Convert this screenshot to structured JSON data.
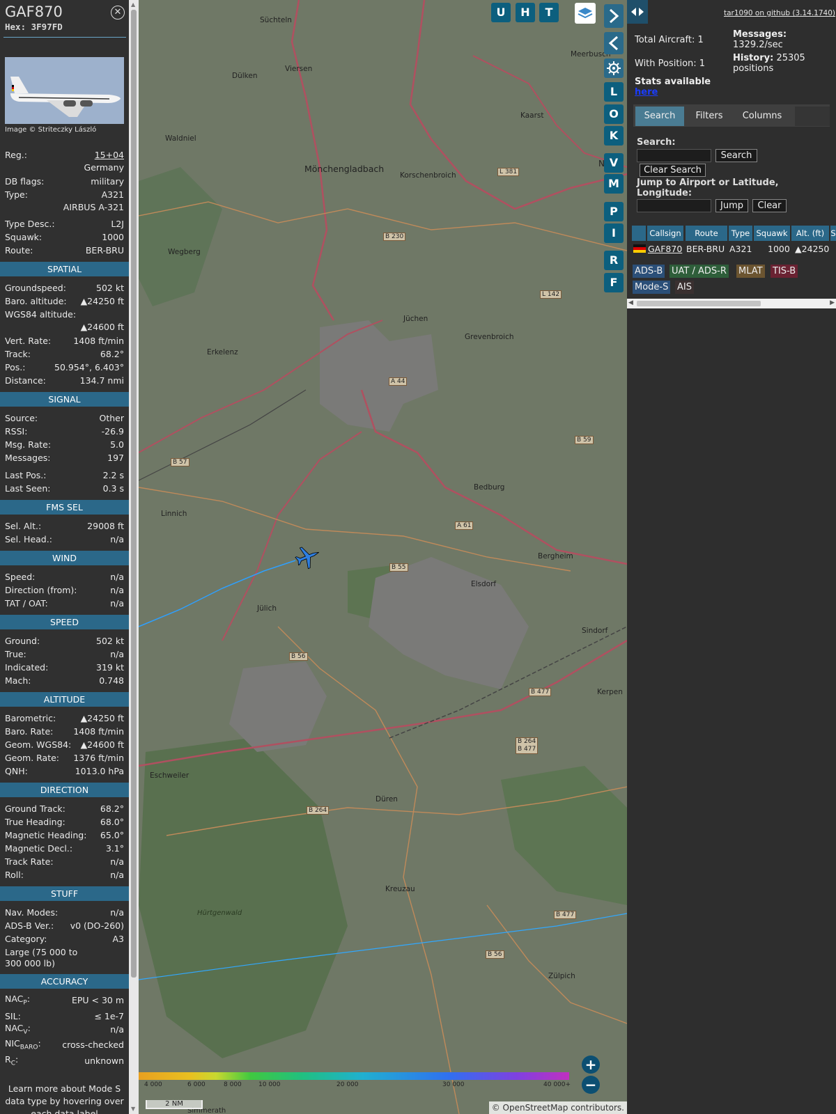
{
  "aircraft": {
    "callsign": "GAF870",
    "hex": "Hex: 3F97FD",
    "photo_credit": "Image © Striteczky László"
  },
  "details": [
    {
      "label": "Reg.:",
      "value": "15+04"
    },
    {
      "label": "",
      "value": "Germany"
    },
    {
      "label": "DB flags:",
      "value": "military"
    },
    {
      "label": "Type:",
      "value": "A321"
    },
    {
      "label": "",
      "value": "AIRBUS A-321"
    },
    {
      "label": "Type Desc.:",
      "value": "L2J"
    },
    {
      "label": "Squawk:",
      "value": "1000"
    },
    {
      "label": "Route:",
      "value": "BER-BRU"
    }
  ],
  "sections": {
    "spatial": "SPATIAL",
    "signal": "SIGNAL",
    "fms": "FMS SEL",
    "wind": "WIND",
    "speed": "SPEED",
    "altitude": "ALTITUDE",
    "direction": "DIRECTION",
    "stuff": "STUFF",
    "accuracy": "ACCURACY"
  },
  "spatial": {
    "groundspeed": {
      "label": "Groundspeed:",
      "value": "502 kt"
    },
    "baro_alt": {
      "label": "Baro. altitude:",
      "value": "▲24250 ft"
    },
    "wgs84_label": "WGS84 altitude:",
    "wgs84_value": "▲24600 ft",
    "vert_rate": {
      "label": "Vert. Rate:",
      "value": "1408 ft/min"
    },
    "track": {
      "label": "Track:",
      "value": "68.2°"
    },
    "pos": {
      "label": "Pos.:",
      "value": "50.954°, 6.403°"
    },
    "distance": {
      "label": "Distance:",
      "value": "134.7 nmi"
    }
  },
  "signal": {
    "source": {
      "label": "Source:",
      "value": "Other"
    },
    "rssi": {
      "label": "RSSI:",
      "value": "-26.9"
    },
    "msg_rate": {
      "label": "Msg. Rate:",
      "value": "5.0"
    },
    "messages": {
      "label": "Messages:",
      "value": "197"
    },
    "last_pos": {
      "label": "Last Pos.:",
      "value": "2.2 s"
    },
    "last_seen": {
      "label": "Last Seen:",
      "value": "0.3 s"
    }
  },
  "fms": {
    "sel_alt": {
      "label": "Sel. Alt.:",
      "value": "29008 ft"
    },
    "sel_head": {
      "label": "Sel. Head.:",
      "value": "n/a"
    }
  },
  "wind": {
    "speed": {
      "label": "Speed:",
      "value": "n/a"
    },
    "direction": {
      "label": "Direction (from):",
      "value": "n/a"
    },
    "tat": {
      "label": "TAT / OAT:",
      "value": "n/a"
    }
  },
  "speed": {
    "ground": {
      "label": "Ground:",
      "value": "502 kt"
    },
    "true": {
      "label": "True:",
      "value": "n/a"
    },
    "indicated": {
      "label": "Indicated:",
      "value": "319 kt"
    },
    "mach": {
      "label": "Mach:",
      "value": "0.748"
    }
  },
  "altitude": {
    "barometric": {
      "label": "Barometric:",
      "value": "▲24250 ft"
    },
    "baro_rate": {
      "label": "Baro. Rate:",
      "value": "1408 ft/min"
    },
    "geom": {
      "label": "Geom. WGS84:",
      "value": "▲24600 ft"
    },
    "geom_rate": {
      "label": "Geom. Rate:",
      "value": "1376 ft/min"
    },
    "qnh": {
      "label": "QNH:",
      "value": "1013.0 hPa"
    }
  },
  "direction": {
    "ground_track": {
      "label": "Ground Track:",
      "value": "68.2°"
    },
    "true_heading": {
      "label": "True Heading:",
      "value": "68.0°"
    },
    "mag_heading": {
      "label": "Magnetic Heading:",
      "value": "65.0°"
    },
    "mag_decl": {
      "label": "Magnetic Decl.:",
      "value": "3.1°"
    },
    "track_rate": {
      "label": "Track Rate:",
      "value": "n/a"
    },
    "roll": {
      "label": "Roll:",
      "value": "n/a"
    }
  },
  "stuff": {
    "nav_modes": {
      "label": "Nav. Modes:",
      "value": "n/a"
    },
    "adsb_ver": {
      "label": "ADS-B Ver.:",
      "value": "v0 (DO-260)"
    },
    "category": {
      "label": "Category:",
      "value": "A3"
    },
    "category_desc_1": "Large (75 000 to",
    "category_desc_2": "300 000 lb)"
  },
  "accuracy": {
    "nacp": {
      "label": "NAC",
      "sub": "P",
      "value": "EPU < 30 m"
    },
    "sil": {
      "label": "SIL:",
      "value": "≤ 1e-7"
    },
    "nacv": {
      "label": "NAC",
      "sub": "V",
      "value": "n/a"
    },
    "nicbaro": {
      "label": "NIC",
      "sub": "BARO",
      "value": "cross-checked"
    },
    "rc": {
      "label": "R",
      "sub": "C",
      "value": "unknown"
    },
    "footer_1": "Learn more about Mode S",
    "footer_2": "data type by hovering over",
    "footer_3": "each data label"
  },
  "map": {
    "buttons": [
      "U",
      "H",
      "T"
    ],
    "side_buttons": [
      "L",
      "O",
      "K",
      "V",
      "M",
      "P",
      "I",
      "R",
      "F"
    ],
    "places": [
      {
        "name": "Süchteln"
      },
      {
        "name": "Viersen"
      },
      {
        "name": "Dülken"
      },
      {
        "name": "Meerbusch"
      },
      {
        "name": "Waldniel"
      },
      {
        "name": "Kaarst"
      },
      {
        "name": "Mönchengladbach"
      },
      {
        "name": "Korschenbroich"
      },
      {
        "name": "Ne"
      },
      {
        "name": "Wegberg"
      },
      {
        "name": "Jüchen"
      },
      {
        "name": "Grevenbroich"
      },
      {
        "name": "Erkelenz"
      },
      {
        "name": "Bedburg"
      },
      {
        "name": "Linnich"
      },
      {
        "name": "Bergheim"
      },
      {
        "name": "Elsdorf"
      },
      {
        "name": "Jülich"
      },
      {
        "name": "Sindorf"
      },
      {
        "name": "Kerpen"
      },
      {
        "name": "Eschweiler"
      },
      {
        "name": "Düren"
      },
      {
        "name": "Kreuzau"
      },
      {
        "name": "Zülpich"
      },
      {
        "name": "Hürtgenwald"
      },
      {
        "name": "Simmerath"
      }
    ],
    "road_labels": [
      "B 230",
      "L 381",
      "B 57",
      "B 59",
      "A 44",
      "A 61",
      "B 55",
      "L 142",
      "B 56",
      "B 477",
      "B 264",
      "B 477",
      "B 264",
      "B 477",
      "B 56"
    ],
    "osm_credit": "© OpenStreetMap contributors.",
    "scale": "2 NM",
    "alt_ticks": [
      "4 000",
      "6 000",
      "8 000",
      "10 000",
      "20 000",
      "30 000",
      "40 000+"
    ]
  },
  "right": {
    "github": "tar1090 on github (3.14.1740)",
    "total_aircraft": "Total Aircraft: 1",
    "with_position": "With Position: 1",
    "messages_label": "Messages:",
    "messages_value": "1329.2/sec",
    "history_label": "History: 25305",
    "history_value": "positions",
    "stats_available": "Stats available",
    "stats_link": "here",
    "tabs": [
      "Search",
      "Filters",
      "Columns"
    ],
    "search_label": "Search:",
    "search_button": "Search",
    "clear_search": "Clear Search",
    "jump_label_1": "Jump to Airport or Latitude,",
    "jump_label_2": "Longitude:",
    "jump_button": "Jump",
    "clear_button": "Clear",
    "table_headers": [
      "Callsign",
      "Route",
      "Type",
      "Squawk",
      "Alt. (ft)",
      "S"
    ],
    "table_row": {
      "callsign": "GAF870",
      "route": "BER-BRU",
      "type": "A321",
      "squawk": "1000",
      "alt": "▲24250"
    },
    "source_tags": [
      "ADS-B",
      "UAT / ADS-R",
      "MLAT",
      "TIS-B",
      "Mode-S",
      "AIS"
    ]
  }
}
